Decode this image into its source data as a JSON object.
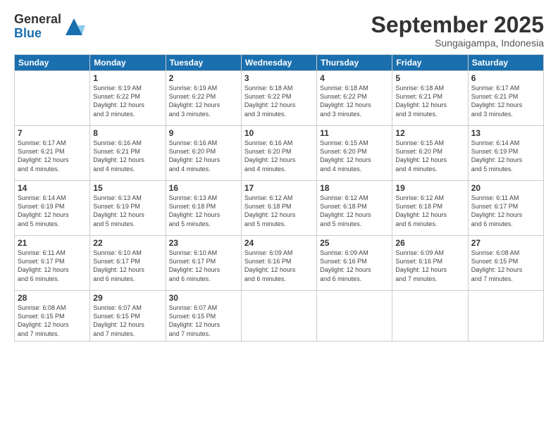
{
  "logo": {
    "general": "General",
    "blue": "Blue"
  },
  "title": "September 2025",
  "subtitle": "Sungaigampa, Indonesia",
  "days": [
    "Sunday",
    "Monday",
    "Tuesday",
    "Wednesday",
    "Thursday",
    "Friday",
    "Saturday"
  ],
  "weeks": [
    [
      {
        "date": "",
        "info": ""
      },
      {
        "date": "1",
        "info": "Sunrise: 6:19 AM\nSunset: 6:22 PM\nDaylight: 12 hours\nand 3 minutes."
      },
      {
        "date": "2",
        "info": "Sunrise: 6:19 AM\nSunset: 6:22 PM\nDaylight: 12 hours\nand 3 minutes."
      },
      {
        "date": "3",
        "info": "Sunrise: 6:18 AM\nSunset: 6:22 PM\nDaylight: 12 hours\nand 3 minutes."
      },
      {
        "date": "4",
        "info": "Sunrise: 6:18 AM\nSunset: 6:22 PM\nDaylight: 12 hours\nand 3 minutes."
      },
      {
        "date": "5",
        "info": "Sunrise: 6:18 AM\nSunset: 6:21 PM\nDaylight: 12 hours\nand 3 minutes."
      },
      {
        "date": "6",
        "info": "Sunrise: 6:17 AM\nSunset: 6:21 PM\nDaylight: 12 hours\nand 3 minutes."
      }
    ],
    [
      {
        "date": "7",
        "info": "Sunrise: 6:17 AM\nSunset: 6:21 PM\nDaylight: 12 hours\nand 4 minutes."
      },
      {
        "date": "8",
        "info": "Sunrise: 6:16 AM\nSunset: 6:21 PM\nDaylight: 12 hours\nand 4 minutes."
      },
      {
        "date": "9",
        "info": "Sunrise: 6:16 AM\nSunset: 6:20 PM\nDaylight: 12 hours\nand 4 minutes."
      },
      {
        "date": "10",
        "info": "Sunrise: 6:16 AM\nSunset: 6:20 PM\nDaylight: 12 hours\nand 4 minutes."
      },
      {
        "date": "11",
        "info": "Sunrise: 6:15 AM\nSunset: 6:20 PM\nDaylight: 12 hours\nand 4 minutes."
      },
      {
        "date": "12",
        "info": "Sunrise: 6:15 AM\nSunset: 6:20 PM\nDaylight: 12 hours\nand 4 minutes."
      },
      {
        "date": "13",
        "info": "Sunrise: 6:14 AM\nSunset: 6:19 PM\nDaylight: 12 hours\nand 5 minutes."
      }
    ],
    [
      {
        "date": "14",
        "info": "Sunrise: 6:14 AM\nSunset: 6:19 PM\nDaylight: 12 hours\nand 5 minutes."
      },
      {
        "date": "15",
        "info": "Sunrise: 6:13 AM\nSunset: 6:19 PM\nDaylight: 12 hours\nand 5 minutes."
      },
      {
        "date": "16",
        "info": "Sunrise: 6:13 AM\nSunset: 6:18 PM\nDaylight: 12 hours\nand 5 minutes."
      },
      {
        "date": "17",
        "info": "Sunrise: 6:12 AM\nSunset: 6:18 PM\nDaylight: 12 hours\nand 5 minutes."
      },
      {
        "date": "18",
        "info": "Sunrise: 6:12 AM\nSunset: 6:18 PM\nDaylight: 12 hours\nand 5 minutes."
      },
      {
        "date": "19",
        "info": "Sunrise: 6:12 AM\nSunset: 6:18 PM\nDaylight: 12 hours\nand 6 minutes."
      },
      {
        "date": "20",
        "info": "Sunrise: 6:11 AM\nSunset: 6:17 PM\nDaylight: 12 hours\nand 6 minutes."
      }
    ],
    [
      {
        "date": "21",
        "info": "Sunrise: 6:11 AM\nSunset: 6:17 PM\nDaylight: 12 hours\nand 6 minutes."
      },
      {
        "date": "22",
        "info": "Sunrise: 6:10 AM\nSunset: 6:17 PM\nDaylight: 12 hours\nand 6 minutes."
      },
      {
        "date": "23",
        "info": "Sunrise: 6:10 AM\nSunset: 6:17 PM\nDaylight: 12 hours\nand 6 minutes."
      },
      {
        "date": "24",
        "info": "Sunrise: 6:09 AM\nSunset: 6:16 PM\nDaylight: 12 hours\nand 6 minutes."
      },
      {
        "date": "25",
        "info": "Sunrise: 6:09 AM\nSunset: 6:16 PM\nDaylight: 12 hours\nand 6 minutes."
      },
      {
        "date": "26",
        "info": "Sunrise: 6:09 AM\nSunset: 6:16 PM\nDaylight: 12 hours\nand 7 minutes."
      },
      {
        "date": "27",
        "info": "Sunrise: 6:08 AM\nSunset: 6:15 PM\nDaylight: 12 hours\nand 7 minutes."
      }
    ],
    [
      {
        "date": "28",
        "info": "Sunrise: 6:08 AM\nSunset: 6:15 PM\nDaylight: 12 hours\nand 7 minutes."
      },
      {
        "date": "29",
        "info": "Sunrise: 6:07 AM\nSunset: 6:15 PM\nDaylight: 12 hours\nand 7 minutes."
      },
      {
        "date": "30",
        "info": "Sunrise: 6:07 AM\nSunset: 6:15 PM\nDaylight: 12 hours\nand 7 minutes."
      },
      {
        "date": "",
        "info": ""
      },
      {
        "date": "",
        "info": ""
      },
      {
        "date": "",
        "info": ""
      },
      {
        "date": "",
        "info": ""
      }
    ]
  ]
}
